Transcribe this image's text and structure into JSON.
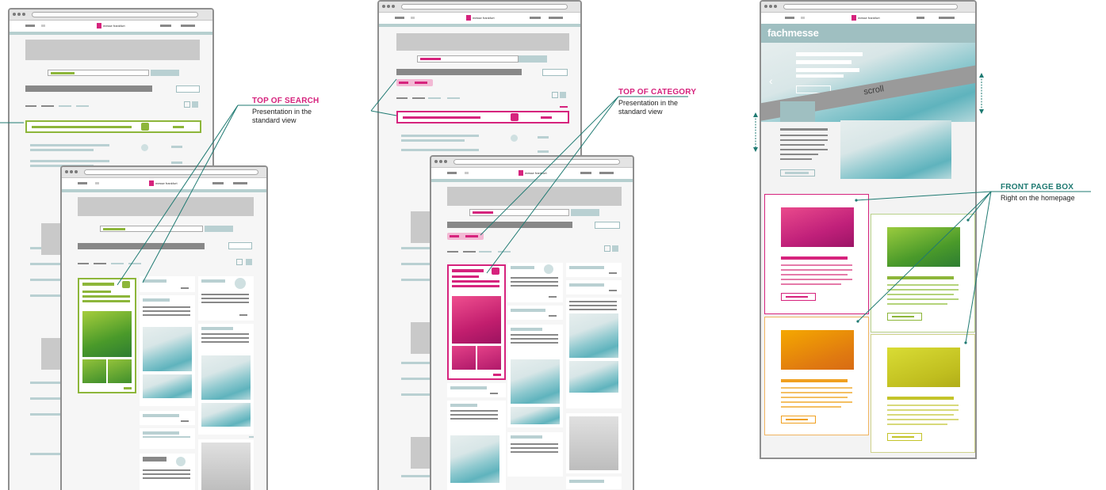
{
  "annotations": {
    "top_of_search": {
      "title": "TOP OF SEARCH",
      "subtitle_line1": "Presentation in the",
      "subtitle_line2": "standard view",
      "color": "#d6237d"
    },
    "top_of_category": {
      "title": "TOP OF CATEGORY",
      "subtitle_line1": "Presentation in the",
      "subtitle_line2": "standard view",
      "color": "#d6237d"
    },
    "front_page_box": {
      "title": "FRONT PAGE BOX",
      "subtitle": "Right on the homepage",
      "color": "#1f7a72"
    }
  },
  "mockups": {
    "logo_text": "messe frankfurt",
    "homepage_brand": "fachmesse",
    "scroll_label": "scroll"
  },
  "colors": {
    "highlight_green": "#8db63a",
    "highlight_pink": "#d6237d",
    "orange": "#f0a020",
    "yellow": "#c4c42a",
    "teal": "#b9d0d2",
    "leader_line": "#1f7a72"
  }
}
